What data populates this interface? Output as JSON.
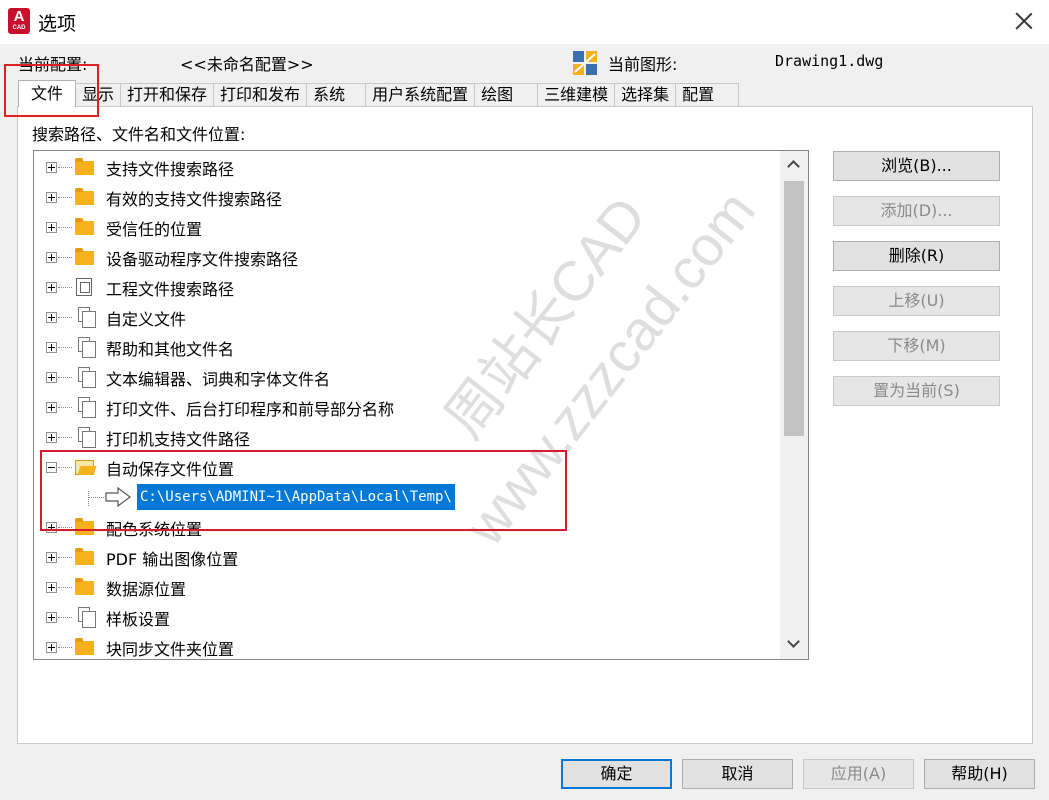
{
  "window": {
    "title": "选项",
    "app_icon_text": "A",
    "app_icon_sub": "CAD"
  },
  "profile": {
    "label": "当前配置:",
    "value": "<<未命名配置>>"
  },
  "drawing": {
    "label": "当前图形:",
    "value": "Drawing1.dwg",
    "icon": "drawing-file-icon"
  },
  "tabs": [
    {
      "label": "文件",
      "active": true
    },
    {
      "label": "显示"
    },
    {
      "label": "打开和保存"
    },
    {
      "label": "打印和发布"
    },
    {
      "label": "系统"
    },
    {
      "label": "用户系统配置"
    },
    {
      "label": "绘图"
    },
    {
      "label": "三维建模"
    },
    {
      "label": "选择集"
    },
    {
      "label": "配置"
    }
  ],
  "search_label": "搜索路径、文件名和文件位置:",
  "tree": {
    "items": [
      {
        "label": "支持文件搜索路径",
        "icon": "folder"
      },
      {
        "label": "有效的支持文件搜索路径",
        "icon": "folder"
      },
      {
        "label": "受信任的位置",
        "icon": "folder"
      },
      {
        "label": "设备驱动程序文件搜索路径",
        "icon": "folder"
      },
      {
        "label": "工程文件搜索路径",
        "icon": "project-book"
      },
      {
        "label": "自定义文件",
        "icon": "pages"
      },
      {
        "label": "帮助和其他文件名",
        "icon": "pages"
      },
      {
        "label": "文本编辑器、词典和字体文件名",
        "icon": "pages"
      },
      {
        "label": "打印文件、后台打印程序和前导部分名称",
        "icon": "pages"
      },
      {
        "label": "打印机支持文件路径",
        "icon": "pages"
      },
      {
        "label": "自动保存文件位置",
        "icon": "folder-open",
        "expanded": true
      },
      {
        "label": "配色系统位置",
        "icon": "folder"
      },
      {
        "label": "PDF 输出图像位置",
        "icon": "folder"
      },
      {
        "label": "数据源位置",
        "icon": "folder"
      },
      {
        "label": "样板设置",
        "icon": "pages"
      },
      {
        "label": "块同步文件夹位置",
        "icon": "folder"
      }
    ],
    "autosave_path": "C:\\Users\\ADMINI~1\\AppData\\Local\\Temp\\"
  },
  "side_buttons": {
    "browse": "浏览(B)...",
    "add": "添加(D)...",
    "delete": "删除(R)",
    "move_up": "上移(U)",
    "move_down": "下移(M)",
    "set_current": "置为当前(S)"
  },
  "footer": {
    "ok": "确定",
    "cancel": "取消",
    "apply": "应用(A)",
    "help": "帮助(H)"
  },
  "watermark": {
    "line1": "周站长CAD",
    "line2": "www.zzzcad.com"
  },
  "colors": {
    "selection": "#0078d7",
    "highlight_box": "#d31c2c",
    "folder": "#f7b21b"
  }
}
